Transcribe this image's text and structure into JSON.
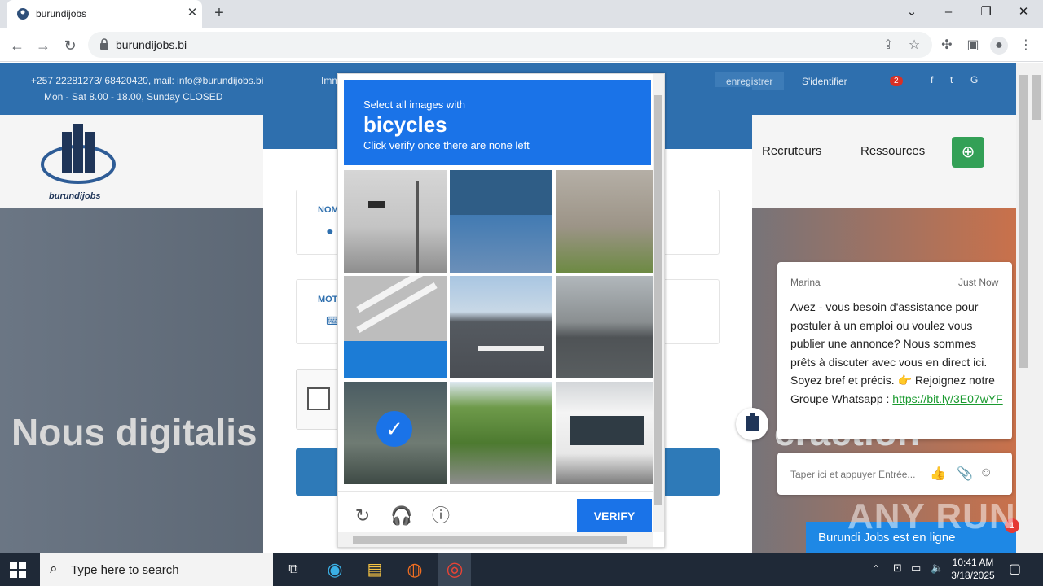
{
  "browser": {
    "tab_title": "burundijobs",
    "url": "burundijobs.bi",
    "close_glyph": "✕",
    "newtab_glyph": "+"
  },
  "site": {
    "contact_phone": "+257 22281273/ 68420420, mail: info@burundijobs.bi",
    "address_partial": "Imm",
    "hours": "Mon - Sat 8.00 - 18.00, Sunday CLOSED",
    "register": "enregistrer",
    "login": "S'identifier",
    "notif_count": "2",
    "logo_text": "burundijobs",
    "nav": [
      "Recruteurs",
      "Ressources"
    ],
    "hero_left": "Nous digitalis",
    "hero_right": "eraction",
    "form_label_nom": "NOM",
    "form_label_mot": "MOT"
  },
  "captcha": {
    "select_text": "Select all images with",
    "object": "bicycles",
    "instruction": "Click verify once there are none left",
    "tiles": [
      {
        "desc": "traffic-light-intersection",
        "selected": false
      },
      {
        "desc": "tree-lined-road",
        "selected": false
      },
      {
        "desc": "building-with-plants",
        "selected": false
      },
      {
        "desc": "crosswalk-closeup",
        "selected": false
      },
      {
        "desc": "road-with-crosswalk",
        "selected": false
      },
      {
        "desc": "street-storefront",
        "selected": false
      },
      {
        "desc": "parked-bicycles",
        "selected": true
      },
      {
        "desc": "road-with-motorbike",
        "selected": false
      },
      {
        "desc": "white-bus",
        "selected": false
      }
    ],
    "verify_label": "VERIFY"
  },
  "chat": {
    "agent": "Marina",
    "time": "Just Now",
    "message": "Avez - vous besoin d'assistance pour postuler à un emploi ou voulez vous publier une annonce? Nous sommes prêts à discuter avec vous en direct ici. Soyez bref et précis. 👉 Rejoignez notre Groupe Whatsapp :",
    "link": "https://bit.ly/3E07wYF",
    "input_placeholder": "Taper ici et appuyer Entrée...",
    "banner": "Burundi Jobs est en ligne",
    "badge": "1"
  },
  "watermark": "ANY RUN",
  "taskbar": {
    "search_placeholder": "Type here to search",
    "time": "10:41 AM",
    "date": "3/18/2025"
  }
}
